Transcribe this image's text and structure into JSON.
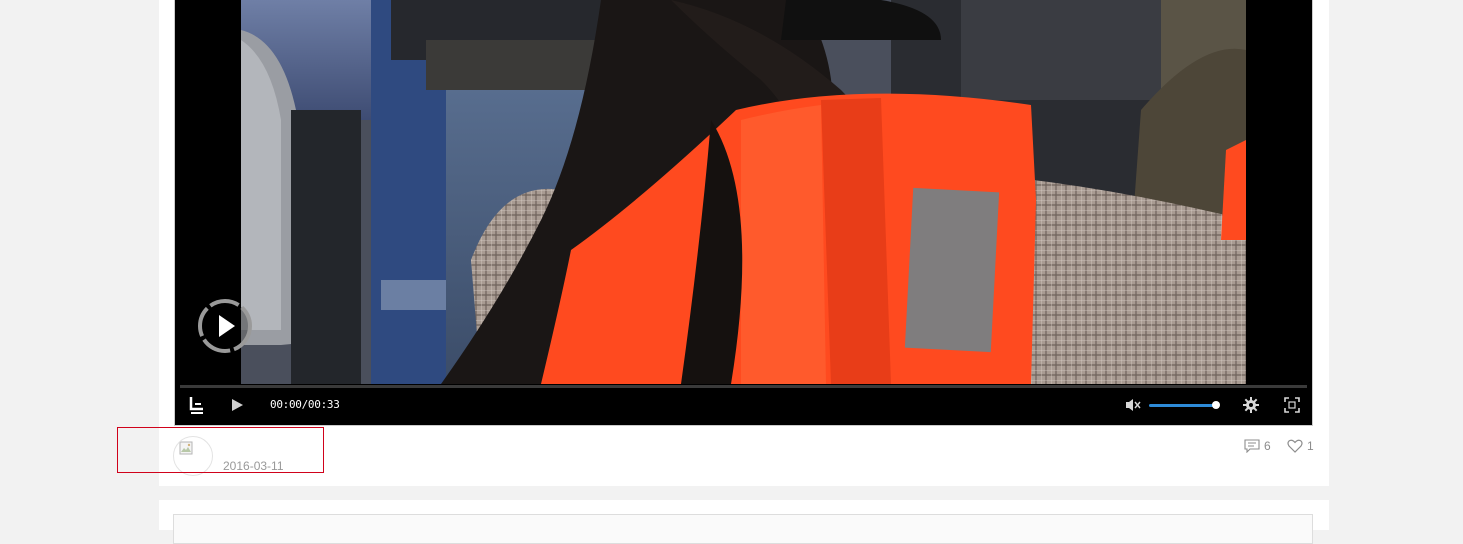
{
  "player": {
    "time_display": "00:00/00:33",
    "progress": 0,
    "volume": 0.9,
    "muted": true
  },
  "post": {
    "date": "2016-03-11",
    "comment_count": "6",
    "like_count": "1"
  },
  "icons": {
    "logo": "letv-logo-icon",
    "play": "play-icon",
    "big_play": "big-play-icon",
    "volume": "volume-muted-icon",
    "settings": "gear-icon",
    "fullscreen": "fullscreen-icon",
    "comment": "comment-icon",
    "like": "heart-icon",
    "avatar": "broken-image-icon"
  },
  "colors": {
    "accent_volume": "#2e8bd8",
    "highlight_box": "#d0021b",
    "muted_text": "#999999",
    "vest_orange": "#ff4a1f"
  }
}
